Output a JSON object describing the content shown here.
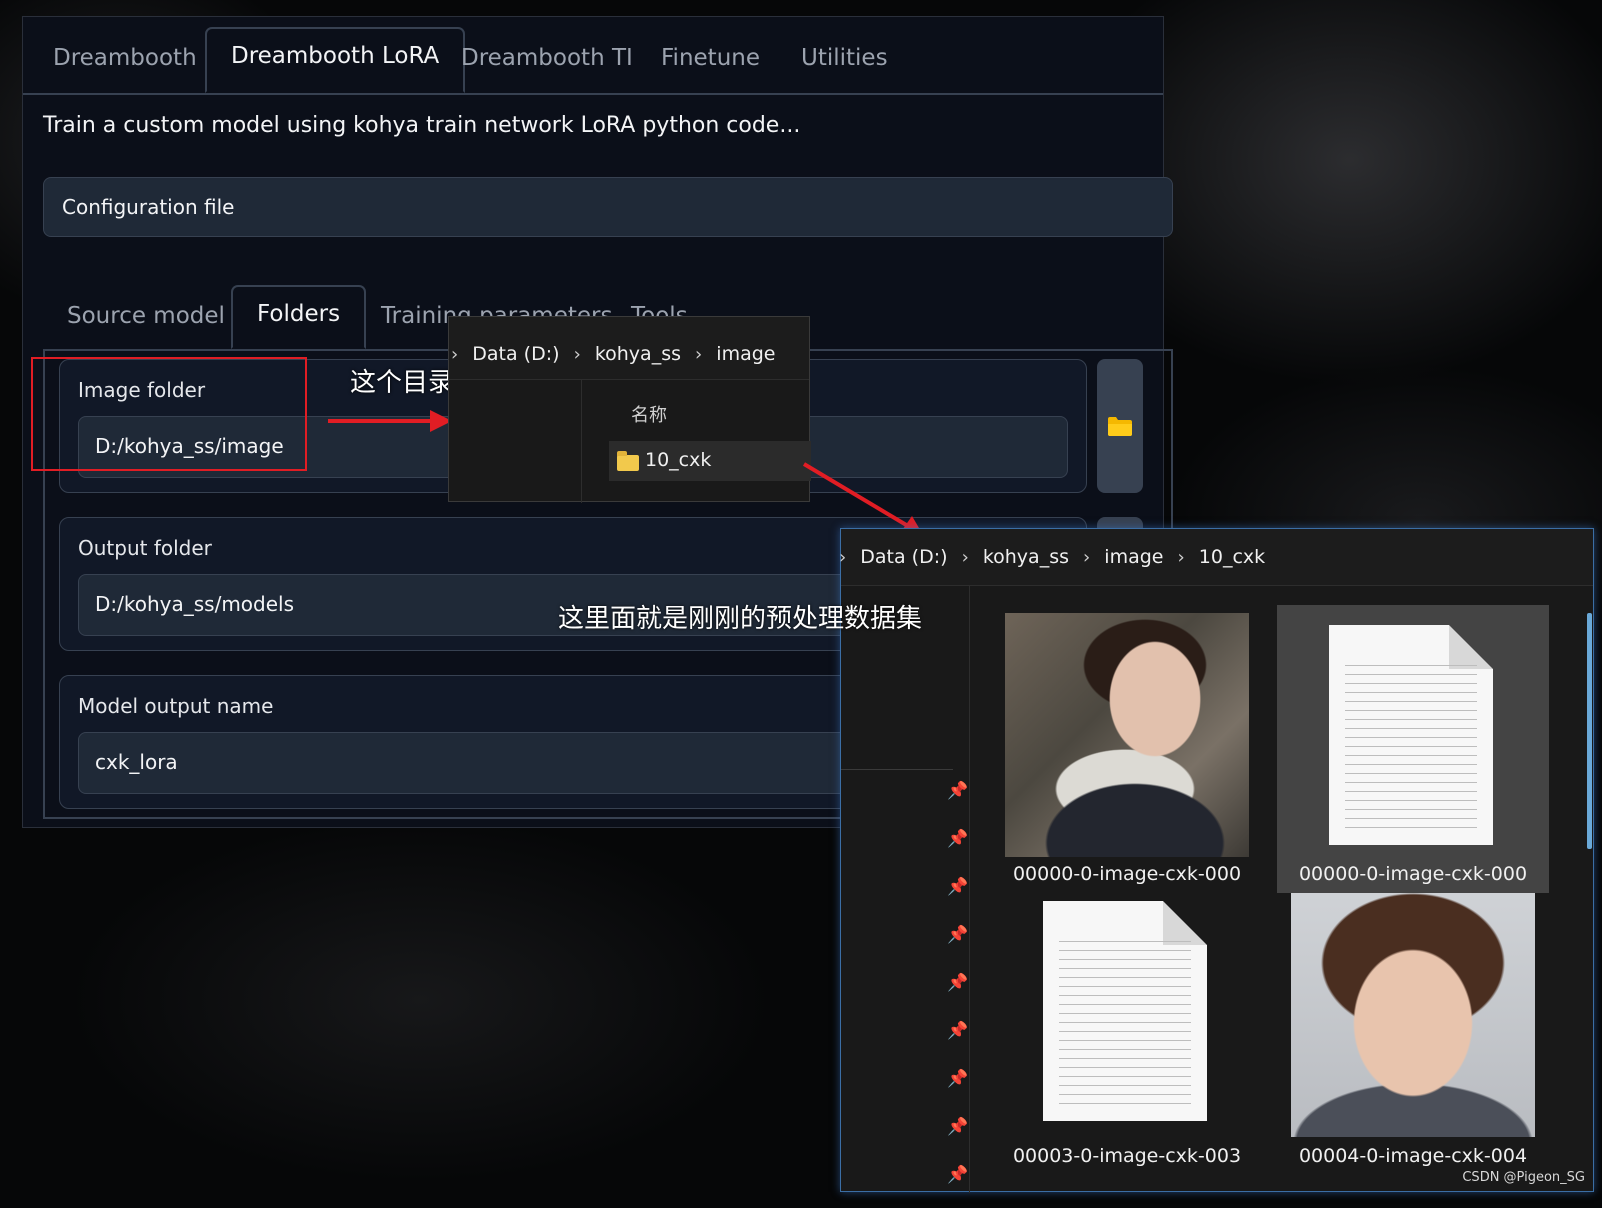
{
  "tabs": [
    "Dreambooth",
    "Dreambooth LoRA",
    "Dreambooth TI",
    "Finetune",
    "Utilities"
  ],
  "description": "Train a custom model using kohya train network LoRA python code...",
  "config_label": "Configuration file",
  "subtabs": [
    "Source model",
    "Folders",
    "Training parameters",
    "Tools"
  ],
  "fields": {
    "image_folder": {
      "label": "Image folder",
      "value": "D:/kohya_ss/image"
    },
    "output_folder": {
      "label": "Output folder",
      "value": "D:/kohya_ss/models"
    },
    "model_output_name": {
      "label": "Model output name",
      "value": "cxk_lora"
    }
  },
  "annotations": {
    "note1": "这个目录长这样",
    "note2": "这里面就是刚刚的预处理数据集"
  },
  "explorer1": {
    "crumbs": [
      "Data (D:)",
      "kohya_ss",
      "image"
    ],
    "column_header": "名称",
    "item": "10_cxk"
  },
  "explorer2": {
    "crumbs": [
      "Data (D:)",
      "kohya_ss",
      "image",
      "10_cxk"
    ],
    "files": [
      {
        "name": "00000-0-image-cxk-000",
        "kind": "photo"
      },
      {
        "name": "00000-0-image-cxk-000",
        "kind": "text"
      },
      {
        "name": "00003-0-image-cxk-003",
        "kind": "text"
      },
      {
        "name": "00004-0-image-cxk-004",
        "kind": "photo"
      }
    ]
  },
  "watermark": "CSDN @Pigeon_SG",
  "colors": {
    "panel_bg": "#0b0f19",
    "block_bg": "#111827",
    "input_bg": "#1f2937",
    "annotation_red": "#e11d24",
    "folder_yellow": "#f2c94c"
  }
}
